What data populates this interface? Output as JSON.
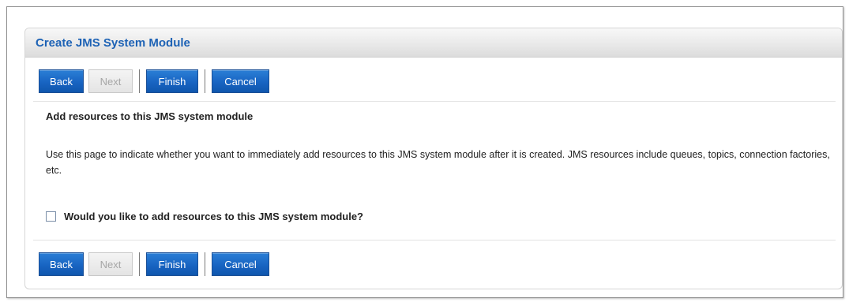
{
  "panel": {
    "title": "Create JMS System Module"
  },
  "toolbar": {
    "back_label": "Back",
    "next_label": "Next",
    "finish_label": "Finish",
    "cancel_label": "Cancel",
    "next_enabled": false
  },
  "content": {
    "heading": "Add resources to this JMS system module",
    "description": "Use this page to indicate whether you want to immediately add resources to this JMS system module after it is created. JMS resources include queues, topics, connection factories, etc.",
    "add_resources_label": "Would you like to add resources to this JMS system module?",
    "add_resources_checked": false
  },
  "colors": {
    "title": "#1d62b5",
    "button": "#1864c2",
    "button_disabled": "#e4e4e4"
  }
}
